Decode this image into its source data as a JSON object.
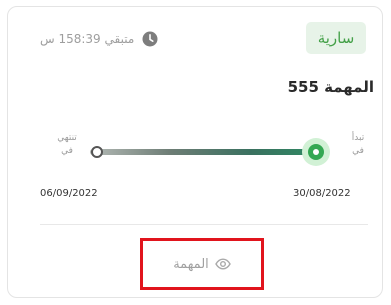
{
  "task": {
    "status_badge": "سارية",
    "remaining_text": "متبقي 158:39 س",
    "title": "المهمة 555",
    "start_label_line1": "تبدأ",
    "start_label_line2": "في",
    "end_label_line1": "تنتهي",
    "end_label_line2": "في",
    "start_date": "30/08/2022",
    "end_date": "06/09/2022",
    "progress_fraction": 0.0,
    "view_button_label": "المهمة"
  },
  "colors": {
    "badge_bg": "#e7f3e8",
    "badge_text": "#43a047",
    "start_dot": "#34a853",
    "highlight_border": "#e1141d"
  },
  "icons": {
    "remaining": "clock-icon",
    "view": "eye-icon"
  }
}
